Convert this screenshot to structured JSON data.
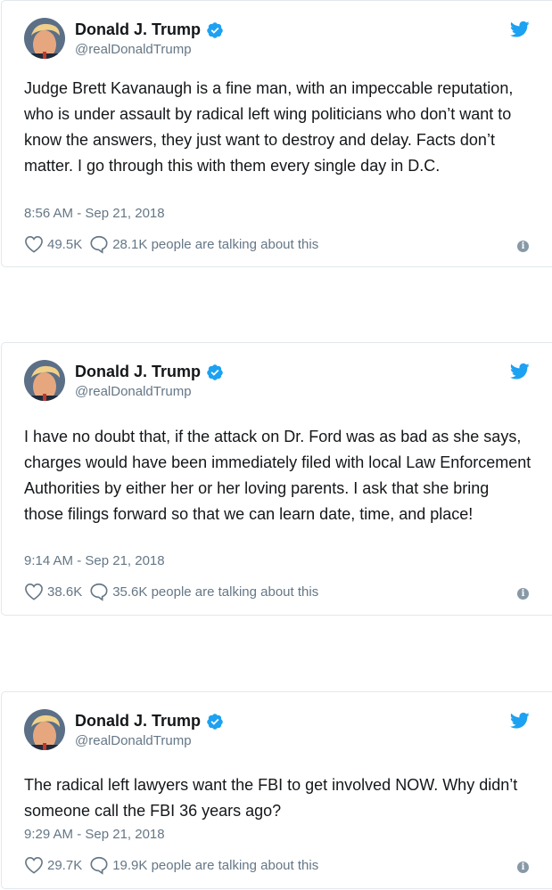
{
  "colors": {
    "verified": "#1da1f2",
    "bird": "#1da1f2",
    "meta": "#657786",
    "border": "#e1e8ed"
  },
  "tweets": [
    {
      "name": "Donald J. Trump",
      "handle": "@realDonaldTrump",
      "text": "Judge Brett Kavanaugh is a fine man, with an impeccable reputation, who is under assault by radical left wing politicians who don’t want to know the answers, they just want to destroy and delay. Facts don’t matter. I go through this with them every single day in D.C.",
      "time": "8:56 AM - Sep 21, 2018",
      "likes": "49.5K",
      "talking": "28.1K people are talking about this"
    },
    {
      "name": "Donald J. Trump",
      "handle": "@realDonaldTrump",
      "text": "I have no doubt that, if the attack on Dr. Ford was as bad as she says, charges would have been immediately filed with local Law Enforcement Authorities by either her or her loving parents. I ask that she bring those filings forward so that we can learn  date, time, and place!",
      "time": "9:14 AM - Sep 21, 2018",
      "likes": "38.6K",
      "talking": "35.6K people are talking about this"
    },
    {
      "name": "Donald J. Trump",
      "handle": "@realDonaldTrump",
      "text": "The radical left lawyers want the FBI to get involved NOW. Why didn’t someone call the FBI 36 years ago?",
      "time": "9:29 AM - Sep 21, 2018",
      "likes": "29.7K",
      "talking": "19.9K people are talking about this"
    }
  ],
  "icons": {
    "verified": "verified-badge-icon",
    "bird": "twitter-bird-icon",
    "like": "heart-icon",
    "reply": "speech-bubble-icon",
    "info": "info-icon",
    "info_glyph": "i"
  }
}
